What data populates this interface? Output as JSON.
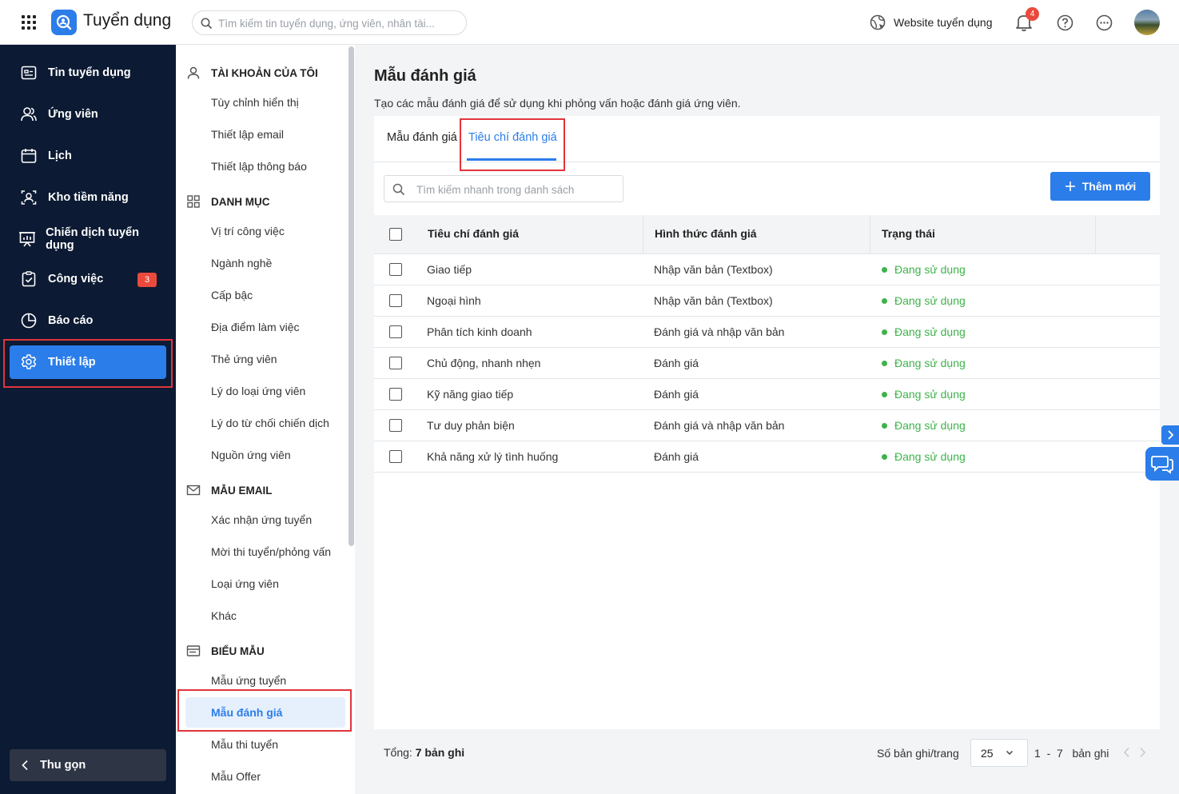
{
  "header": {
    "app_title": "Tuyển dụng",
    "search_placeholder": "Tìm kiếm tin tuyển dụng, ứng viên, nhân tài...",
    "website_label": "Website tuyển dụng",
    "notification_count": "4",
    "icons": [
      "apps-grid-icon",
      "app-logo-icon",
      "search-icon",
      "globe-icon",
      "bell-icon",
      "help-icon",
      "more-icon",
      "avatar"
    ]
  },
  "sidebar": {
    "items": [
      {
        "label": "Tin tuyển dụng",
        "icon": "job-post-icon"
      },
      {
        "label": "Ứng viên",
        "icon": "candidates-icon"
      },
      {
        "label": "Lịch",
        "icon": "calendar-icon"
      },
      {
        "label": "Kho tiềm năng",
        "icon": "talent-pool-icon"
      },
      {
        "label": "Chiến dịch tuyển dụng",
        "icon": "campaign-icon"
      },
      {
        "label": "Công việc",
        "icon": "task-icon",
        "badge": "3"
      },
      {
        "label": "Báo cáo",
        "icon": "report-icon"
      },
      {
        "label": "Thiết lập",
        "icon": "settings-icon",
        "active": true
      }
    ],
    "collapse_label": "Thu gọn"
  },
  "settings_menu": {
    "sections": [
      {
        "title": "TÀI KHOẢN CỦA TÔI",
        "icon": "user-icon",
        "items": [
          "Tùy chỉnh hiển thị",
          "Thiết lập email",
          "Thiết lập thông báo"
        ]
      },
      {
        "title": "DANH MỤC",
        "icon": "grid-icon",
        "items": [
          "Vị trí công việc",
          "Ngành nghề",
          "Cấp bậc",
          "Địa điểm làm việc",
          "Thẻ ứng viên",
          "Lý do loại ứng viên",
          "Lý do từ chối chiến dịch",
          "Nguồn ứng viên"
        ]
      },
      {
        "title": "MẪU EMAIL",
        "icon": "mail-icon",
        "items": [
          "Xác nhận ứng tuyển",
          "Mời thi tuyển/phỏng vấn",
          "Loại ứng viên",
          "Khác"
        ]
      },
      {
        "title": "BIỂU MẪU",
        "icon": "form-icon",
        "items": [
          "Mẫu ứng tuyển",
          "Mẫu đánh giá",
          "Mẫu thi tuyển",
          "Mẫu Offer"
        ]
      }
    ],
    "active_item": "Mẫu đánh giá"
  },
  "main": {
    "title": "Mẫu đánh giá",
    "subtitle": "Tạo các mẫu đánh giá để sử dụng khi phỏng vấn hoặc đánh giá ứng viên.",
    "tabs": [
      {
        "label": "Mẫu đánh giá",
        "active": false
      },
      {
        "label": "Tiêu chí đánh giá",
        "active": true
      }
    ],
    "quick_search_placeholder": "Tìm kiếm nhanh trong danh sách",
    "add_button": "Thêm mới",
    "table": {
      "columns": [
        "Tiêu chí đánh giá",
        "Hình thức đánh giá",
        "Trạng thái"
      ],
      "rows": [
        {
          "criteria": "Giao tiếp",
          "type": "Nhập văn bản (Textbox)",
          "status": "Đang sử dụng"
        },
        {
          "criteria": "Ngoại hình",
          "type": "Nhập văn bản (Textbox)",
          "status": "Đang sử dụng"
        },
        {
          "criteria": "Phân tích kinh doanh",
          "type": "Đánh giá và nhập văn bản",
          "status": "Đang sử dụng"
        },
        {
          "criteria": "Chủ động, nhanh nhẹn",
          "type": "Đánh giá",
          "status": "Đang sử dụng"
        },
        {
          "criteria": "Kỹ năng giao tiếp",
          "type": "Đánh giá",
          "status": "Đang sử dụng"
        },
        {
          "criteria": "Tư duy phản biện",
          "type": "Đánh giá và nhập văn bản",
          "status": "Đang sử dụng"
        },
        {
          "criteria": "Khả năng xử lý tình huống",
          "type": "Đánh giá",
          "status": "Đang sử dụng"
        }
      ]
    },
    "footer": {
      "total_label": "Tổng:",
      "total_value": "7 bản ghi",
      "per_page_label": "Số bản ghi/trang",
      "per_page_value": "25",
      "range": "1  -  7   bản ghi"
    }
  },
  "colors": {
    "primary": "#2b7de9",
    "sidebar_bg": "#0c1a33",
    "status_active": "#3db34a",
    "badge": "#ea4a3d",
    "highlight": "#e0353b"
  }
}
